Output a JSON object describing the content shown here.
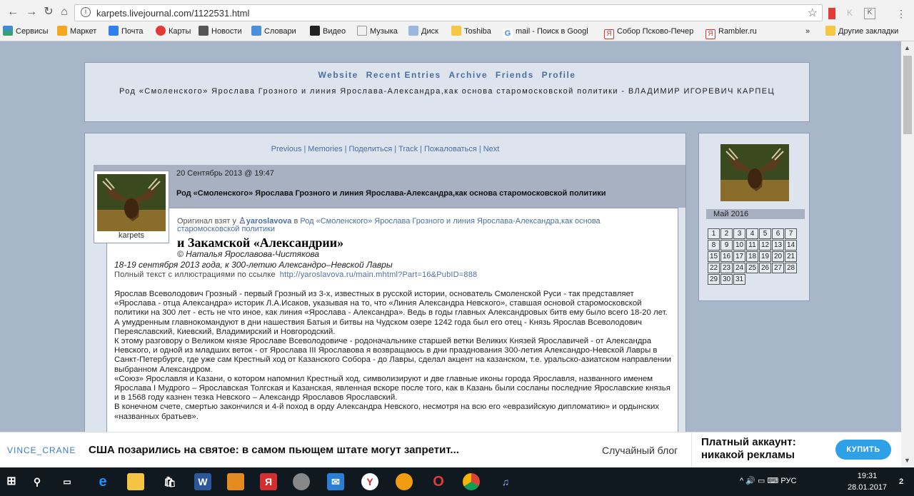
{
  "browser": {
    "url": "karpets.livejournal.com/1122531.html",
    "bookmarks": [
      "Сервисы",
      "Маркет",
      "Почта",
      "Карты",
      "Новости",
      "Словари",
      "Видео",
      "Музыка",
      "Диск",
      "Toshiba",
      "mail - Поиск в Googl",
      "Собор Псково-Печер",
      "Rambler.ru",
      "»",
      "Другие закладки"
    ]
  },
  "header": {
    "links": [
      "Website",
      "Recent Entries",
      "Archive",
      "Friends",
      "Profile"
    ],
    "title": "Род «Смоленского» Ярослава Грозного и линия Ярослава-Александра,как основа старомосковской политики - ВЛАДИМИР ИГОРЕВИЧ КАРПЕЦ"
  },
  "entry_nav": [
    "Previous",
    "Memories",
    "Поделиться",
    "Track",
    "Пожаловаться",
    "Next"
  ],
  "entry": {
    "username": "karpets",
    "date": "20 Сентябрь 2013 @ 19:47",
    "subject": "Род «Смоленского» Ярослава Грозного и линия Ярослава-Александра,как основа старомосковской политики",
    "orig_prefix": "Оригинал взят у",
    "orig_user": "yaroslavova",
    "orig_in": "в",
    "orig_link": "Род «Смоленского» Ярослава Грозного и линия Ярослава-Александра,как основа старомосковской политики",
    "heading": "и Закамской «Александрии»",
    "author": "© Наталья Ярославова-Чистякова",
    "dateline": "18-19 сентября 2013 года, к 300-летию Александро–Невской Лавры",
    "fulltext_label": "Полный текст с иллюстрациями по ссылке",
    "fulltext_url": "http://yaroslavova.ru/main.mhtml?Part=16&PubID=888",
    "paragraphs": [
      "Ярослав Всеволодович Грозный - первый Грозный из 3-х, известных в русской истории, основатель Смоленской Руси - так представляет «Ярослава - отца Александра» историк Л.А.Исаков, указывая на то, что «Линия Александра Невского», ставшая основой старомосковской политики на 300 лет - есть не что иное, как линия «Ярослава - Александра». Ведь в годы главных Александровых битв ему было всего 18-20 лет. А умудренным главнокомандуют в дни нашествия Батыя и битвы на Чудском озере 1242 года был его отец - Князь Ярослав Всеволодович Переяславский, Киевский, Владимирский и Новгородский.",
      "К этому разговору о Великом князе Ярославе Всеволодовиче - родоначальнике старшей ветки Великих Князей Ярославичей - от Александра Невского, и одной из младших веток - от Ярослава III Ярославова я возвращаюсь в дни празднования 300-летия Александро-Невской Лавры в Санкт-Петербурге, где уже сам Крестный ход от Казанского Собора - до Лавры, сделал акцент на казанском, т.е. уральско-азиатском направлении выбранном Александром.",
      "«Союз» Ярославля и Казани, о котором напомнил Крестный ход, символизируют и две главные иконы города Ярославля, названного именем Ярослава I Мудрого – Ярославская Толгская и Казанская, явленная вскоре после того, как в Казань были сосланы последние Ярославские князья и в 1568 году казнен тезка Невского – Александр Ярославов Ярославский.",
      "В конечном счете, смертью закончился и 4-й поход в орду Александра Невского, несмотря на всю его «евразийскую дипломатию» и ордынских «названных братьев»."
    ]
  },
  "sidebar": {
    "month": "Май 2016",
    "days": [
      "1",
      "2",
      "3",
      "4",
      "5",
      "6",
      "7",
      "8",
      "9",
      "10",
      "11",
      "12",
      "13",
      "14",
      "15",
      "16",
      "17",
      "18",
      "19",
      "20",
      "21",
      "22",
      "23",
      "24",
      "25",
      "26",
      "27",
      "28",
      "29",
      "30",
      "31"
    ]
  },
  "promo": {
    "user": "VINCE_CRANE",
    "headline": "США позарились на святое: в самом пьющем штате могут запретит...",
    "random": "Случайный блог",
    "account": "Платный аккаунт: никакой рекламы",
    "buy": "КУПИТЬ"
  },
  "taskbar": {
    "lang": "РУС",
    "time": "19:31",
    "date": "28.01.2017",
    "notifications": "2"
  }
}
